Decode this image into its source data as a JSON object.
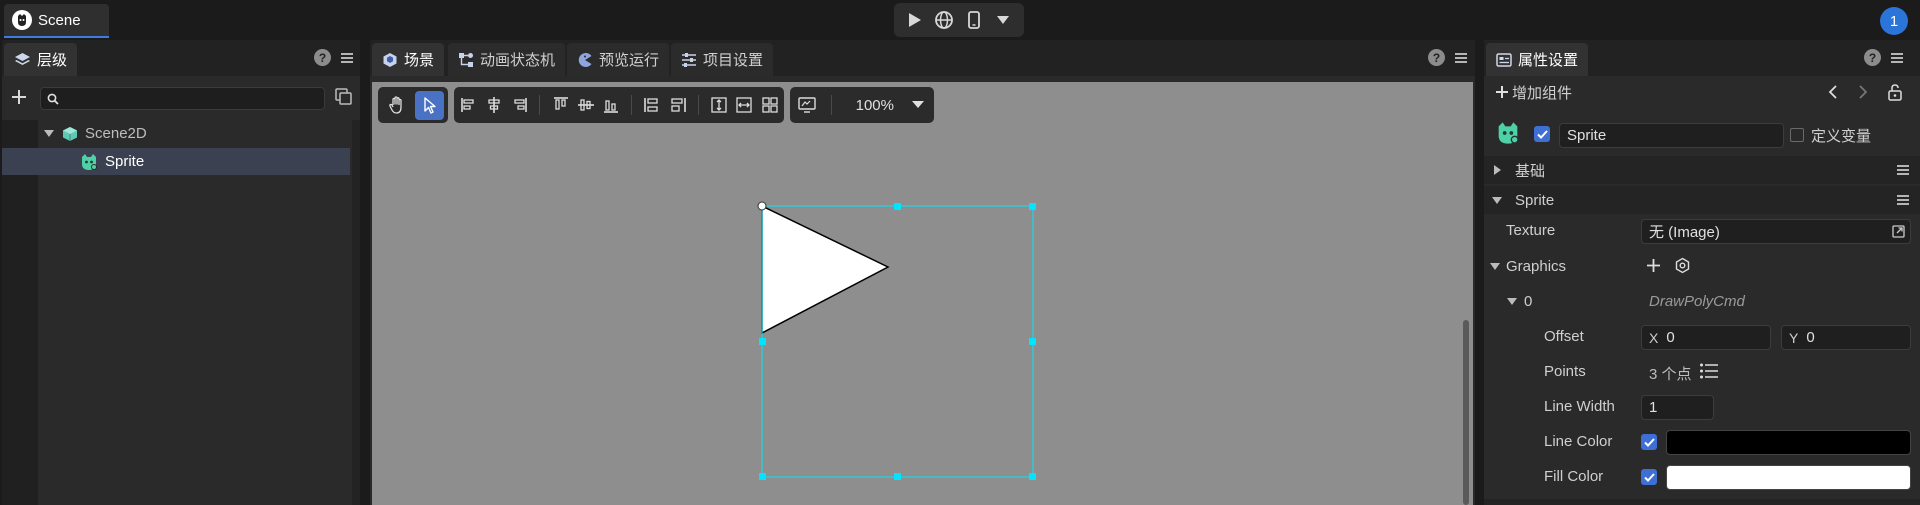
{
  "topbar": {
    "scene_tab": "Scene",
    "notification_count": "1"
  },
  "hierarchy": {
    "tab_label": "层级",
    "search_placeholder": "",
    "tree": [
      {
        "label": "Scene2D",
        "icon": "cube-icon"
      },
      {
        "label": "Sprite",
        "icon": "sprite-icon"
      }
    ]
  },
  "center": {
    "tabs": [
      {
        "label": "场景"
      },
      {
        "label": "动画状态机"
      },
      {
        "label": "预览运行"
      },
      {
        "label": "项目设置"
      }
    ],
    "zoom": "100%"
  },
  "scene_content": {
    "shape": "triangle",
    "fill_color": "#ffffff",
    "line_color": "#000000",
    "selection_color": "#00e5ff",
    "viewport_bg": "#8e8e8e"
  },
  "inspector": {
    "tab_label": "属性设置",
    "add_component": "增加组件",
    "node_name": "Sprite",
    "define_var_label": "定义变量",
    "section_basic": "基础",
    "section_sprite": "Sprite",
    "texture_label": "Texture",
    "texture_value": "无 (Image)",
    "graphics_label": "Graphics",
    "item_index": "0",
    "item_type": "DrawPolyCmd",
    "offset_label": "Offset",
    "offset_x_label": "X",
    "offset_x": "0",
    "offset_y_label": "Y",
    "offset_y": "0",
    "points_label": "Points",
    "points_value": "3 个点",
    "line_width_label": "Line Width",
    "line_width": "1",
    "line_color_label": "Line Color",
    "line_color": "#000000",
    "fill_color_label": "Fill Color",
    "fill_color": "#ffffff"
  },
  "colors": {
    "accent": "#3d7be0",
    "selected_row": "#3b4150",
    "active_tool": "#4a72c4"
  }
}
